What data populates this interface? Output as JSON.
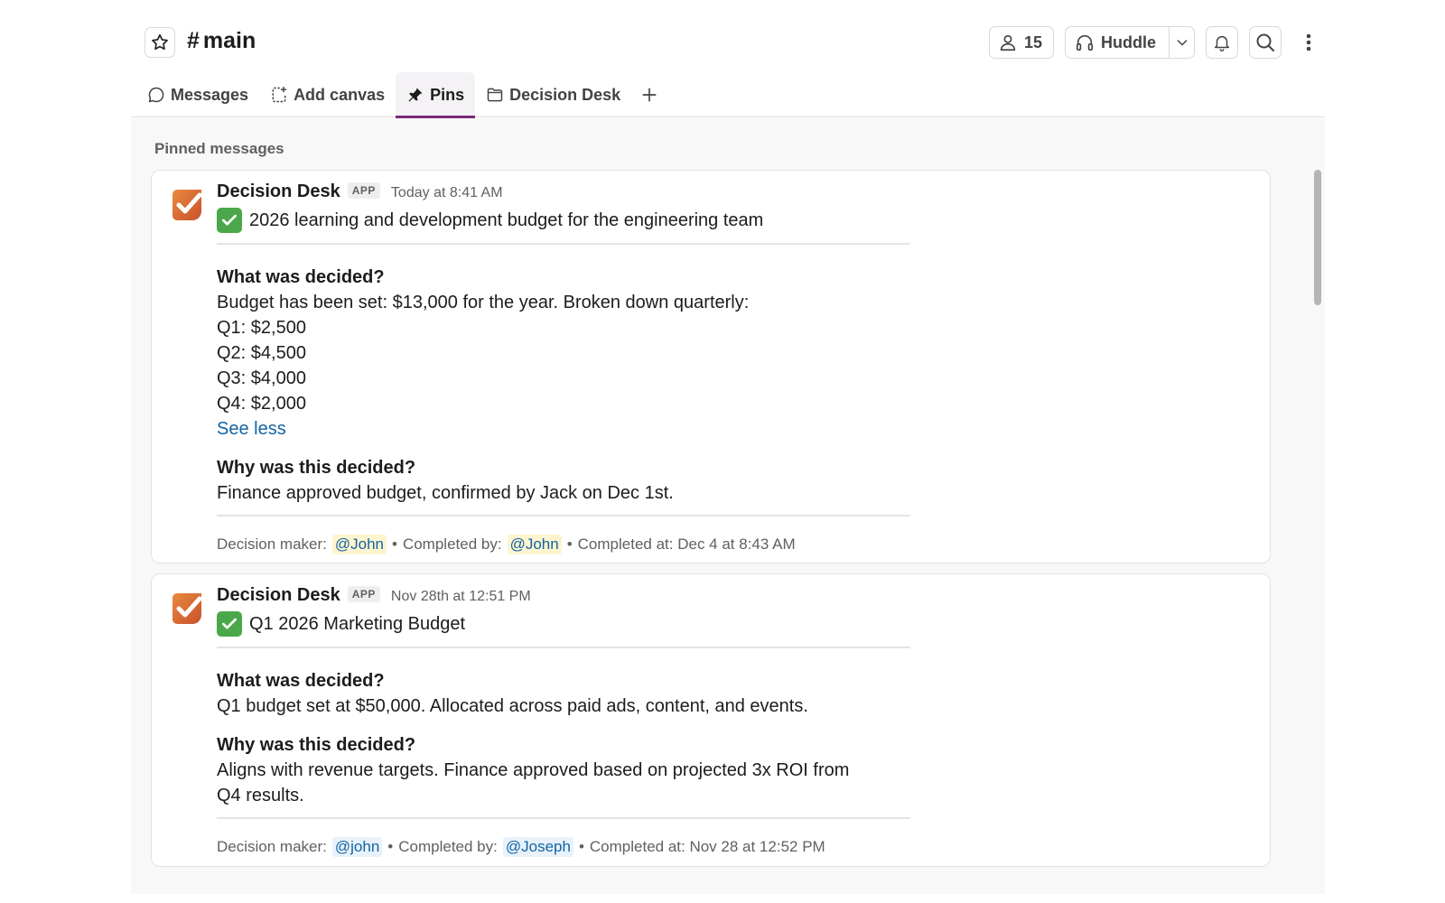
{
  "header": {
    "channel_hash": "#",
    "channel_name": "main",
    "member_count": "15",
    "huddle_label": "Huddle"
  },
  "tabs": [
    {
      "label": "Messages"
    },
    {
      "label": "Add canvas"
    },
    {
      "label": "Pins"
    },
    {
      "label": "Decision Desk"
    }
  ],
  "pins": {
    "section_title": "Pinned messages",
    "messages": [
      {
        "sender": "Decision Desk",
        "badge": "APP",
        "time": "Today at 8:41 AM",
        "title": "2026 learning and development budget for the engineering team",
        "what_label": "What was decided?",
        "what_lines": [
          "Budget has been set: $13,000 for the year. Broken down quarterly:",
          "Q1: $2,500",
          "Q2: $4,500",
          "Q3: $4,000",
          "Q4: $2,000"
        ],
        "see_less": "See less",
        "why_label": "Why was this decided?",
        "why_lines": [
          "Finance approved budget, confirmed by Jack on Dec 1st."
        ],
        "footer": {
          "maker_label": "Decision maker:",
          "maker": "@John",
          "sep": "•",
          "completed_by_label": "Completed by:",
          "completed_by": "@John",
          "completed_at": "Completed at: Dec 4 at 8:43 AM"
        }
      },
      {
        "sender": "Decision Desk",
        "badge": "APP",
        "time": "Nov 28th at 12:51 PM",
        "title": "Q1 2026 Marketing Budget",
        "what_label": "What was decided?",
        "what_lines": [
          "Q1 budget set at $50,000. Allocated across paid ads, content, and events."
        ],
        "why_label": "Why was this decided?",
        "why_lines": [
          "Aligns with revenue targets. Finance approved based on projected 3x ROI from",
          "Q4 results."
        ],
        "footer": {
          "maker_label": "Decision maker:",
          "maker": "@john",
          "sep": "•",
          "completed_by_label": "Completed by:",
          "completed_by": "@Joseph",
          "completed_at": "Completed at: Nov 28 at 12:52 PM"
        }
      }
    ]
  },
  "colors": {
    "accent_tab": "#7a2a7a",
    "link": "#1264a3",
    "logo_orange": "#e07a3a",
    "check_green": "#4aa84a"
  },
  "icons": [
    "star-icon",
    "person-icon",
    "headphones-icon",
    "chevron-down-icon",
    "bell-icon",
    "search-icon",
    "kebab-icon",
    "chat-bubble-icon",
    "canvas-icon",
    "pin-icon",
    "folder-icon",
    "plus-icon",
    "decision-desk-logo",
    "check-icon"
  ]
}
